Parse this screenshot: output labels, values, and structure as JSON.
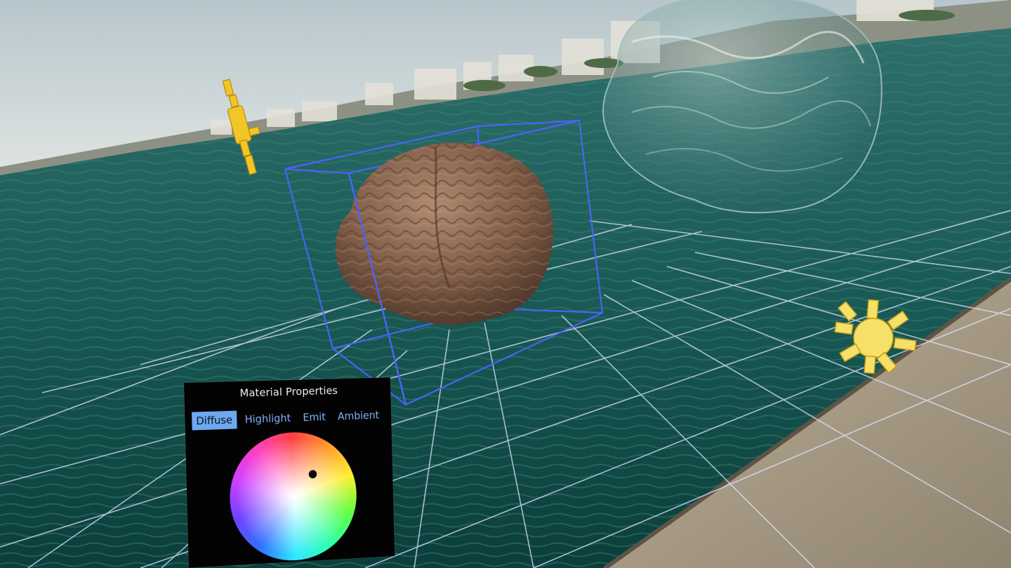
{
  "panel": {
    "title": "Material Properties",
    "tabs": [
      {
        "label": "Diffuse",
        "active": true
      },
      {
        "label": "Highlight",
        "active": false
      },
      {
        "label": "Emit",
        "active": false
      },
      {
        "label": "Ambient",
        "active": false
      }
    ]
  },
  "colors": {
    "sky": "#c9d6d8",
    "sea": "#124f4a",
    "pier": "#a69980",
    "bounding_box": "#4e62ff",
    "grid": "#dfe4ff",
    "brain": "#8a664f",
    "light_icon": "#f2d44a",
    "tab_active_bg": "#6fa8f0",
    "tab_text": "#7fb2ff"
  },
  "icons": [
    "light-icon",
    "directional-light-icon"
  ]
}
